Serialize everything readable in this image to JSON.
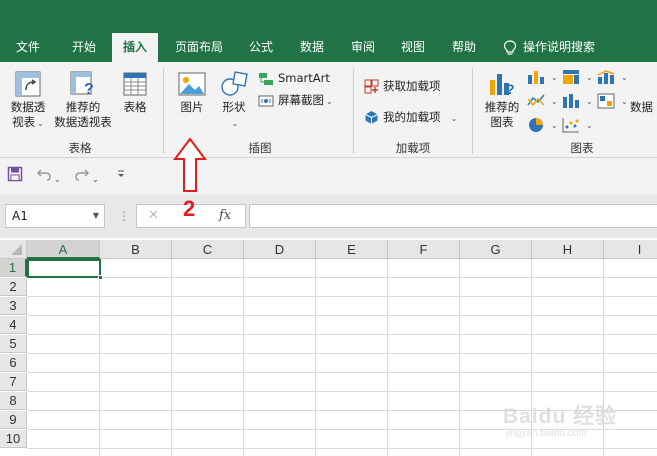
{
  "ribbon_tabs": [
    "文件",
    "开始",
    "插入",
    "页面布局",
    "公式",
    "数据",
    "审阅",
    "视图",
    "帮助"
  ],
  "active_tab": "插入",
  "tell_me": "操作说明搜索",
  "groups": {
    "tables": {
      "label": "表格",
      "pivot_line1": "数据透",
      "pivot_line2": "视表",
      "recommended_line1": "推荐的",
      "recommended_line2": "数据透视表",
      "table": "表格"
    },
    "illustrations": {
      "label": "插图",
      "pictures": "图片",
      "shapes": "形状",
      "smartart": "SmartArt",
      "screenshot": "屏幕截图"
    },
    "addins": {
      "label": "加载项",
      "get_addins": "获取加载项",
      "my_addins": "我的加载项"
    },
    "charts": {
      "label": "图表",
      "recommended_line1": "推荐的",
      "recommended_line2": "图表",
      "overflow": "数据"
    }
  },
  "name_box": "A1",
  "fx_label": "fx",
  "cancel_symbol": "✕",
  "columns": [
    "A",
    "B",
    "C",
    "D",
    "E",
    "F",
    "G",
    "H",
    "I"
  ],
  "rows": [
    "1",
    "2",
    "3",
    "4",
    "5",
    "6",
    "7",
    "8",
    "9",
    "10"
  ],
  "selected_cell": "A1",
  "annotation": {
    "step": "2",
    "color": "#e21d1d"
  },
  "watermark": {
    "brand": "Baidu 经验",
    "url": "jingyan.baidu.com"
  },
  "colors": {
    "brand_green": "#217346",
    "ribbon_bg": "#f3f3f3"
  }
}
